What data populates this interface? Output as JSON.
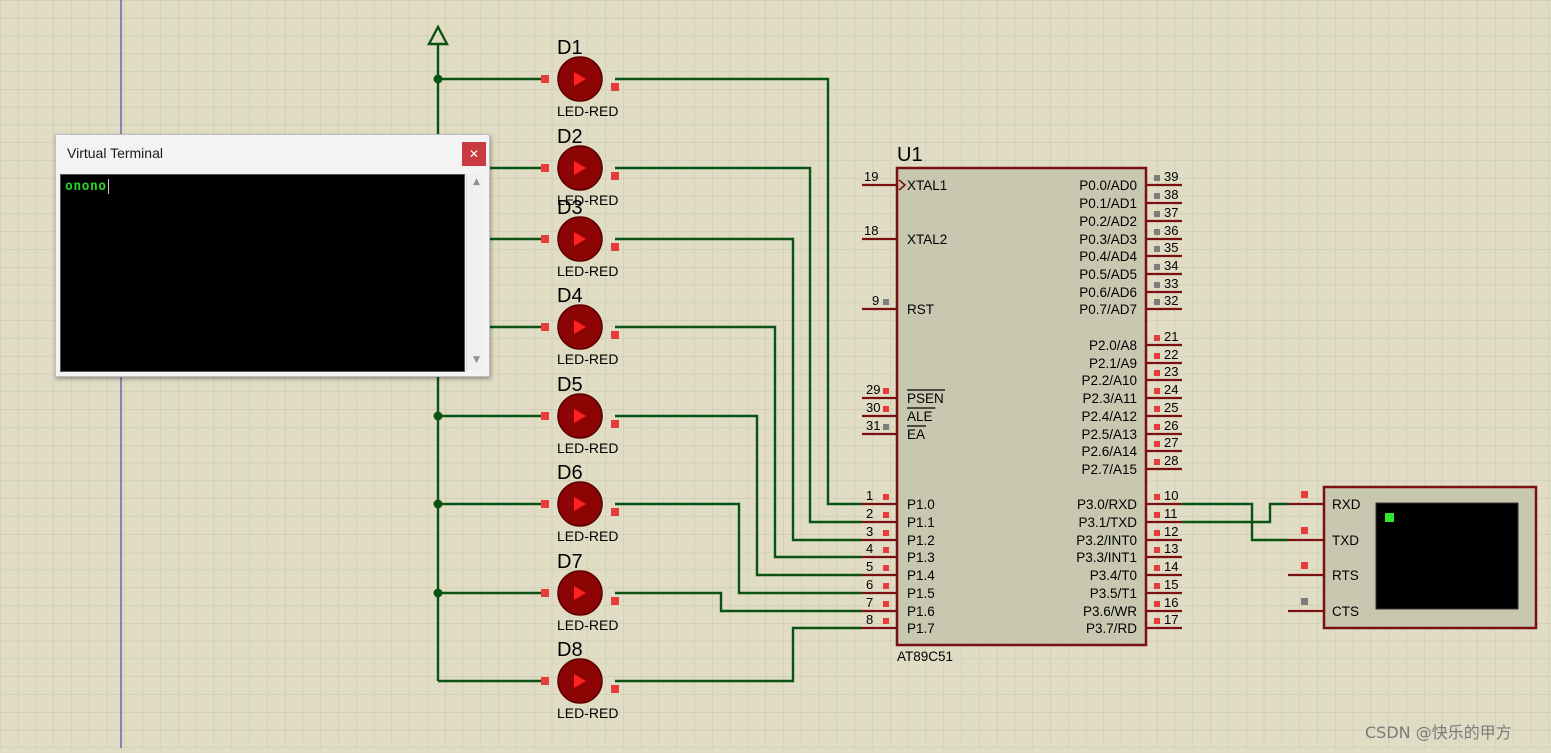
{
  "power_symbol": "",
  "leds": [
    {
      "ref": "D1",
      "type": "LED-RED"
    },
    {
      "ref": "D2",
      "type": "LED-RED"
    },
    {
      "ref": "D3",
      "type": "LED-RED"
    },
    {
      "ref": "D4",
      "type": "LED-RED"
    },
    {
      "ref": "D5",
      "type": "LED-RED"
    },
    {
      "ref": "D6",
      "type": "LED-RED"
    },
    {
      "ref": "D7",
      "type": "LED-RED"
    },
    {
      "ref": "D8",
      "type": "LED-RED"
    }
  ],
  "mcu": {
    "ref": "U1",
    "part": "AT89C51",
    "left_pins": [
      {
        "num": "19",
        "name": "XTAL1"
      },
      {
        "num": "18",
        "name": "XTAL2"
      },
      {
        "num": "9",
        "name": "RST"
      },
      {
        "num": "29",
        "name": "PSEN"
      },
      {
        "num": "30",
        "name": "ALE"
      },
      {
        "num": "31",
        "name": "EA"
      },
      {
        "num": "1",
        "name": "P1.0"
      },
      {
        "num": "2",
        "name": "P1.1"
      },
      {
        "num": "3",
        "name": "P1.2"
      },
      {
        "num": "4",
        "name": "P1.3"
      },
      {
        "num": "5",
        "name": "P1.4"
      },
      {
        "num": "6",
        "name": "P1.5"
      },
      {
        "num": "7",
        "name": "P1.6"
      },
      {
        "num": "8",
        "name": "P1.7"
      }
    ],
    "right_pins": [
      {
        "num": "39",
        "name": "P0.0/AD0"
      },
      {
        "num": "38",
        "name": "P0.1/AD1"
      },
      {
        "num": "37",
        "name": "P0.2/AD2"
      },
      {
        "num": "36",
        "name": "P0.3/AD3"
      },
      {
        "num": "35",
        "name": "P0.4/AD4"
      },
      {
        "num": "34",
        "name": "P0.5/AD5"
      },
      {
        "num": "33",
        "name": "P0.6/AD6"
      },
      {
        "num": "32",
        "name": "P0.7/AD7"
      },
      {
        "num": "21",
        "name": "P2.0/A8"
      },
      {
        "num": "22",
        "name": "P2.1/A9"
      },
      {
        "num": "23",
        "name": "P2.2/A10"
      },
      {
        "num": "24",
        "name": "P2.3/A11"
      },
      {
        "num": "25",
        "name": "P2.4/A12"
      },
      {
        "num": "26",
        "name": "P2.5/A13"
      },
      {
        "num": "27",
        "name": "P2.6/A14"
      },
      {
        "num": "28",
        "name": "P2.7/A15"
      },
      {
        "num": "10",
        "name": "P3.0/RXD"
      },
      {
        "num": "11",
        "name": "P3.1/TXD"
      },
      {
        "num": "12",
        "name": "P3.2/INT0"
      },
      {
        "num": "13",
        "name": "P3.3/INT1"
      },
      {
        "num": "14",
        "name": "P3.4/T0"
      },
      {
        "num": "15",
        "name": "P3.5/T1"
      },
      {
        "num": "16",
        "name": "P3.6/WR"
      },
      {
        "num": "17",
        "name": "P3.7/RD"
      }
    ]
  },
  "terminal_component": {
    "pins": [
      "RXD",
      "TXD",
      "RTS",
      "CTS"
    ]
  },
  "terminal_window": {
    "title": "Virtual Terminal",
    "close_glyph": "✕",
    "content": "onono",
    "scroll_up": "▲",
    "scroll_down": "▼"
  },
  "watermark": "CSDN @快乐的甲方",
  "colors": {
    "background": "#e0ddc4",
    "grid": "#c8c5ac",
    "wire": "#0b5312",
    "component_outline": "#7a1010",
    "chip_fill": "#c8c8b0",
    "led_fill": "#8c0404",
    "led_arrow": "#ff2020",
    "pin_active": "#e83b3b",
    "pin_inactive": "#7d7d7d",
    "terminal_text": "#27d22a"
  }
}
